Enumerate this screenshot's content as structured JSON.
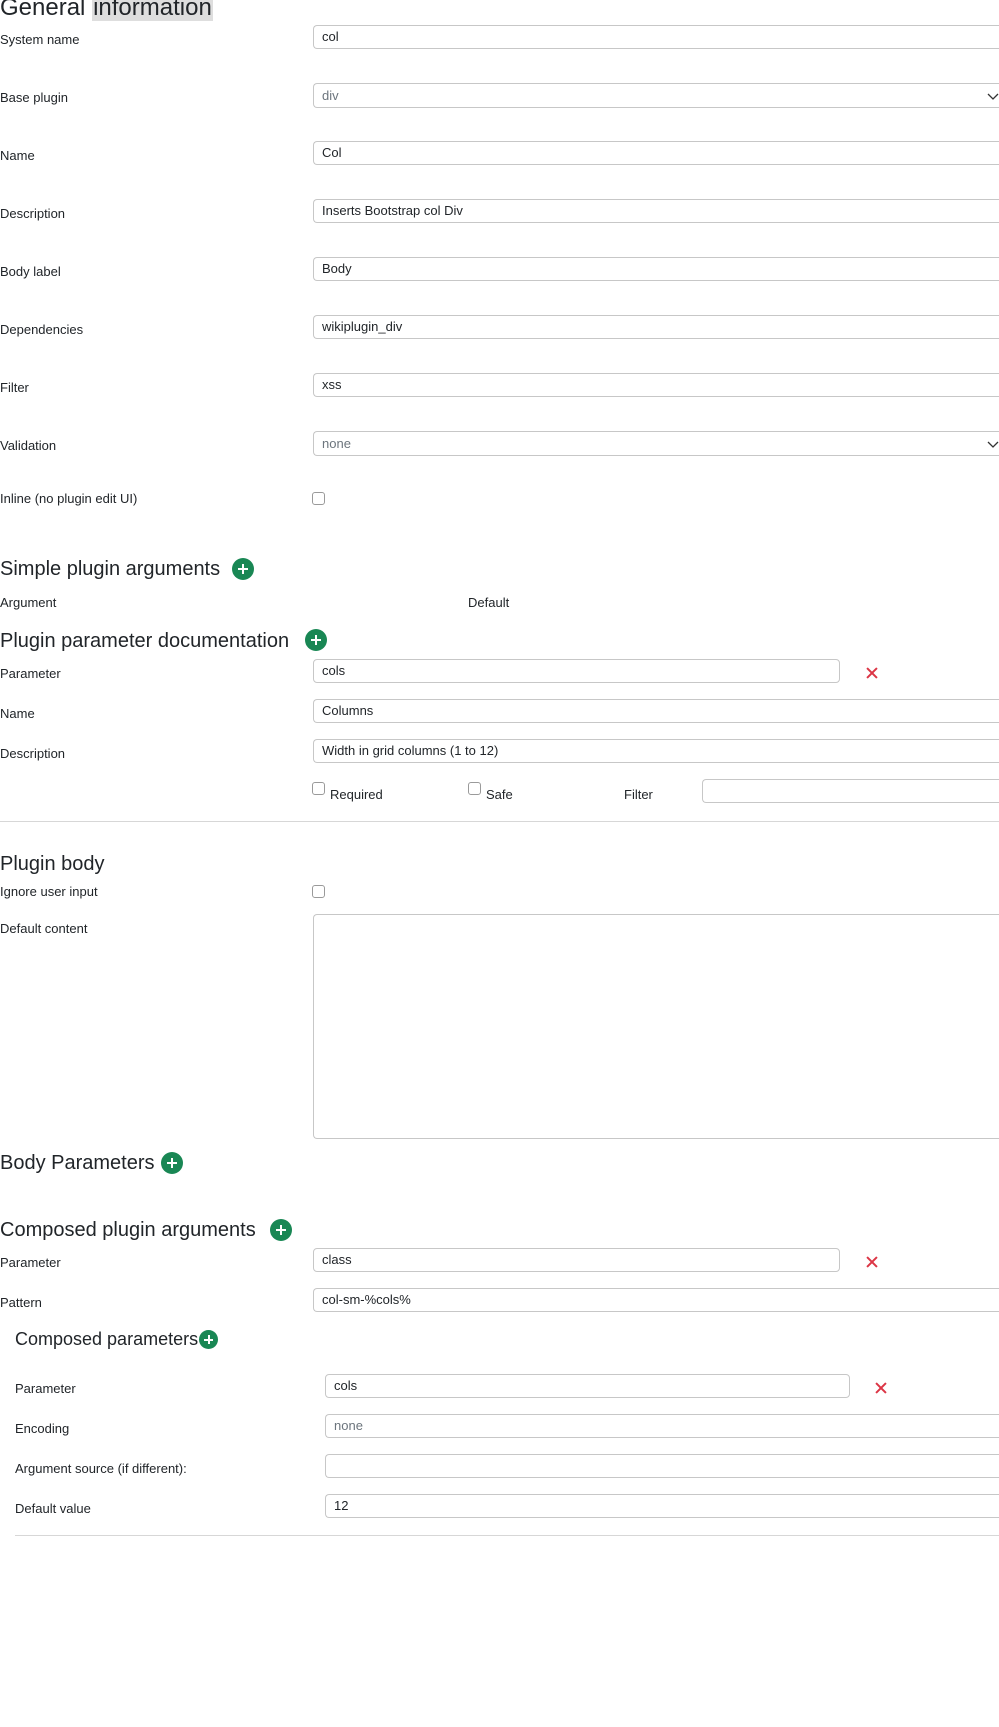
{
  "general": {
    "title_part1": "General",
    "title_part2": "information",
    "fields": [
      {
        "label": "System name",
        "value": "col"
      },
      {
        "label": "Base plugin",
        "value": "div"
      },
      {
        "label": "Name",
        "value": "Col"
      },
      {
        "label": "Description",
        "value": "Inserts Bootstrap col Div"
      },
      {
        "label": "Body label",
        "value": "Body"
      },
      {
        "label": "Dependencies",
        "value": "wikiplugin_div"
      },
      {
        "label": "Filter",
        "value": "xss"
      },
      {
        "label": "Validation",
        "value": "none"
      },
      {
        "label": "Inline (no plugin edit UI)",
        "checked": false
      }
    ]
  },
  "simple_args": {
    "title": "Simple plugin arguments",
    "col_argument": "Argument",
    "col_default": "Default"
  },
  "param_docs": {
    "title": "Plugin parameter documentation",
    "parameter_label": "Parameter",
    "parameter_value": "cols",
    "name_label": "Name",
    "name_value": "Columns",
    "description_label": "Description",
    "description_value": "Width in grid columns (1 to 12)",
    "required_label": "Required",
    "safe_label": "Safe",
    "filter_label": "Filter",
    "filter_value": ""
  },
  "plugin_body": {
    "title": "Plugin body",
    "ignore_label": "Ignore user input",
    "default_content_label": "Default content",
    "default_content_value": ""
  },
  "body_params": {
    "title": "Body Parameters"
  },
  "composed_args": {
    "title": "Composed plugin arguments",
    "parameter_label": "Parameter",
    "parameter_value": "class",
    "pattern_label": "Pattern",
    "pattern_value": "col-sm-%cols%"
  },
  "composed_params": {
    "title": "Composed parameters",
    "parameter_label": "Parameter",
    "parameter_value": "cols",
    "encoding_label": "Encoding",
    "encoding_value": "none",
    "argsource_label": "Argument source (if different):",
    "argsource_value": "",
    "default_label": "Default value",
    "default_value": "12"
  },
  "colors": {
    "add": "#198754",
    "remove": "#dc3545",
    "border": "#c7c7c7"
  }
}
